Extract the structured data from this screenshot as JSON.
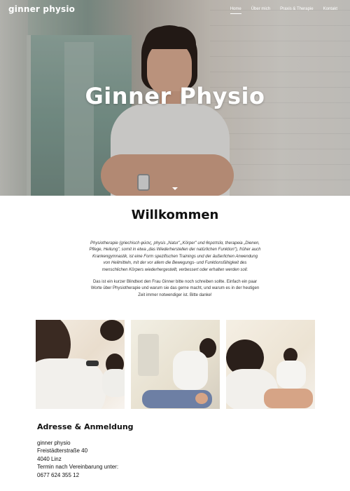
{
  "nav": {
    "logo": "ginner physio",
    "items": [
      {
        "label": "Home",
        "active": true
      },
      {
        "label": "Über mich",
        "active": false
      },
      {
        "label": "Praxis & Therapie",
        "active": false
      },
      {
        "label": "Kontakt",
        "active": false
      }
    ]
  },
  "hero": {
    "title": "Ginner Physio",
    "scroll_icon": "chevron-down-icon"
  },
  "welcome": {
    "title": "Willkommen",
    "intro_lines": [
      "Physiotherapie (griechisch φύσις, physis „Natur\",„Körper\" und θεραπεία, therapeia „Dienen,",
      "Pflege, Heilung\", somit in etwa „das Wiederherstellen der natürlichen Funktion\"), früher auch",
      "Krankengymnastik, ist eine Form spezifischen Trainings und der äußerlichen Anwendung",
      "von Heilmitteln,  mit der vor allem die Bewegungs- und Funktionsfähigkeit des",
      "menschlichen Körpers wiederhergestellt, verbessert oder erhalten werden  soll."
    ],
    "body_lines": [
      "Das ist ein kurzer Blindtext den Frau Ginner bitte noch schreiben sollte. Einfach ein paar",
      "Worte über Physiotherapie und warum sie das gerne macht, und warum es in der heutigen",
      "Zeit immer notwendiger ist. Bitte danke!"
    ]
  },
  "gallery": {
    "photos": [
      "photo-training-dumbbells",
      "photo-massage-therapy",
      "photo-shoulder-therapy"
    ]
  },
  "address": {
    "title": "Adresse & Anmeldung",
    "lines": [
      "ginner physio",
      "Freistädterstraße 40",
      "4040 Linz",
      "Termin nach Vereinbarung unter:",
      "0677 624 355 12"
    ]
  },
  "colors": {
    "hero_text": "#ffffff",
    "heading": "#111111",
    "body_text": "#333333",
    "background": "#ffffff"
  }
}
